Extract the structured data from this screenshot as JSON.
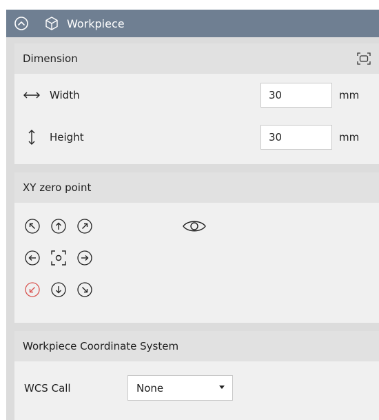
{
  "panel": {
    "title": "Workpiece",
    "header_bg": "#6f7f92"
  },
  "dimension": {
    "title": "Dimension",
    "width_label": "Width",
    "width_value": "30",
    "width_unit": "mm",
    "height_label": "Height",
    "height_value": "30",
    "height_unit": "mm"
  },
  "xy_zero": {
    "title": "XY zero point",
    "selected": "bottom-left",
    "selected_color": "#d9534f"
  },
  "wcs": {
    "title": "Workpiece Coordinate System",
    "call_label": "WCS Call",
    "call_value": "None"
  }
}
